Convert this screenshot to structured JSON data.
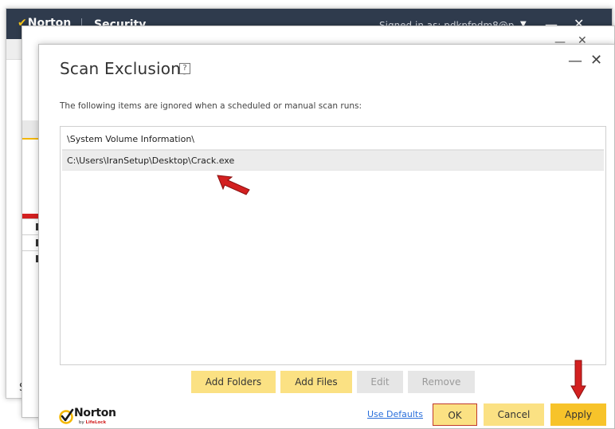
{
  "back_window": {
    "brand": "Norton",
    "product": "Security",
    "signed_in": "Signed in as: pdkpfpdm8@p",
    "caret": "▼",
    "minimize": "—",
    "close": "✕",
    "bottom_letter": "S"
  },
  "middle_window": {
    "minimize": "—",
    "close": "✕"
  },
  "dialog": {
    "title": "Scan Exclusions",
    "help": "?",
    "minimize": "—",
    "close": "✕",
    "description": "The following items are ignored when a scheduled or manual scan runs:",
    "items": [
      {
        "path": "\\System Volume Information\\"
      },
      {
        "path": "C:\\Users\\IranSetup\\Desktop\\Crack.exe"
      }
    ],
    "selected_index": 1,
    "buttons": {
      "add_folders": "Add Folders",
      "add_files": "Add Files",
      "edit": "Edit",
      "remove": "Remove",
      "use_defaults": "Use Defaults",
      "ok": "OK",
      "cancel": "Cancel",
      "apply": "Apply"
    },
    "logo": {
      "word": "Norton",
      "sub_prefix": "by",
      "sub_brand": "LifeLock"
    }
  },
  "icons": {
    "annotation_arrow": "red-arrow-icon",
    "norton_check": "norton-check-icon"
  },
  "colors": {
    "accent_yellow": "#f7c32a",
    "button_yellow": "#fbe183",
    "annotation_red": "#d32020",
    "titlebar_dark": "#2f3b4d",
    "link_blue": "#2a6fdb"
  }
}
